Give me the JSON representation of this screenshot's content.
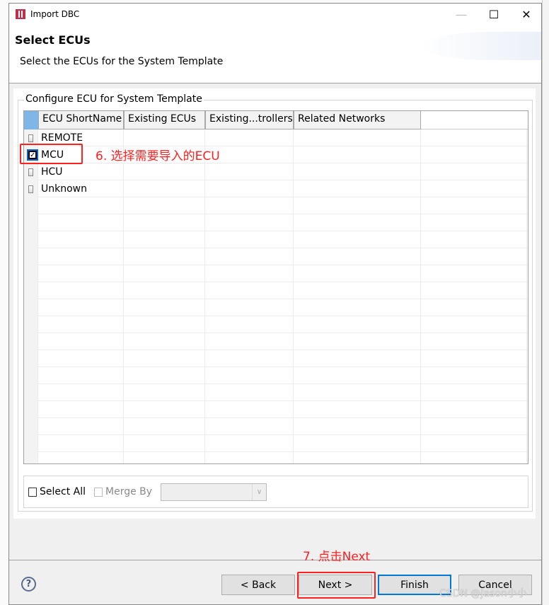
{
  "window": {
    "title": "Import DBC",
    "minimize_icon": "minimize-icon",
    "maximize_icon": "maximize-icon",
    "close_icon": "close-icon"
  },
  "header": {
    "title": "Select ECUs",
    "description": "Select the ECUs for the System Template"
  },
  "group": {
    "label": "Configure ECU for System Template"
  },
  "table": {
    "columns": [
      "ECU ShortName",
      "Existing ECUs",
      "Existing...trollers",
      "Related Networks"
    ],
    "rows": [
      {
        "name": "REMOTE",
        "checked": false
      },
      {
        "name": "MCU",
        "checked": true
      },
      {
        "name": "HCU",
        "checked": false
      },
      {
        "name": "Unknown",
        "checked": false
      }
    ]
  },
  "options": {
    "select_all": "Select All",
    "merge_by": "Merge By",
    "merge_by_value": ""
  },
  "buttons": {
    "back": "< Back",
    "next": "Next >",
    "finish": "Finish",
    "cancel": "Cancel"
  },
  "annotations": {
    "step6": "6. 选择需要导入的ECU",
    "step7": "7. 点击Next",
    "accent": "#ff2020"
  },
  "watermark": "CSDN @Jason小小"
}
